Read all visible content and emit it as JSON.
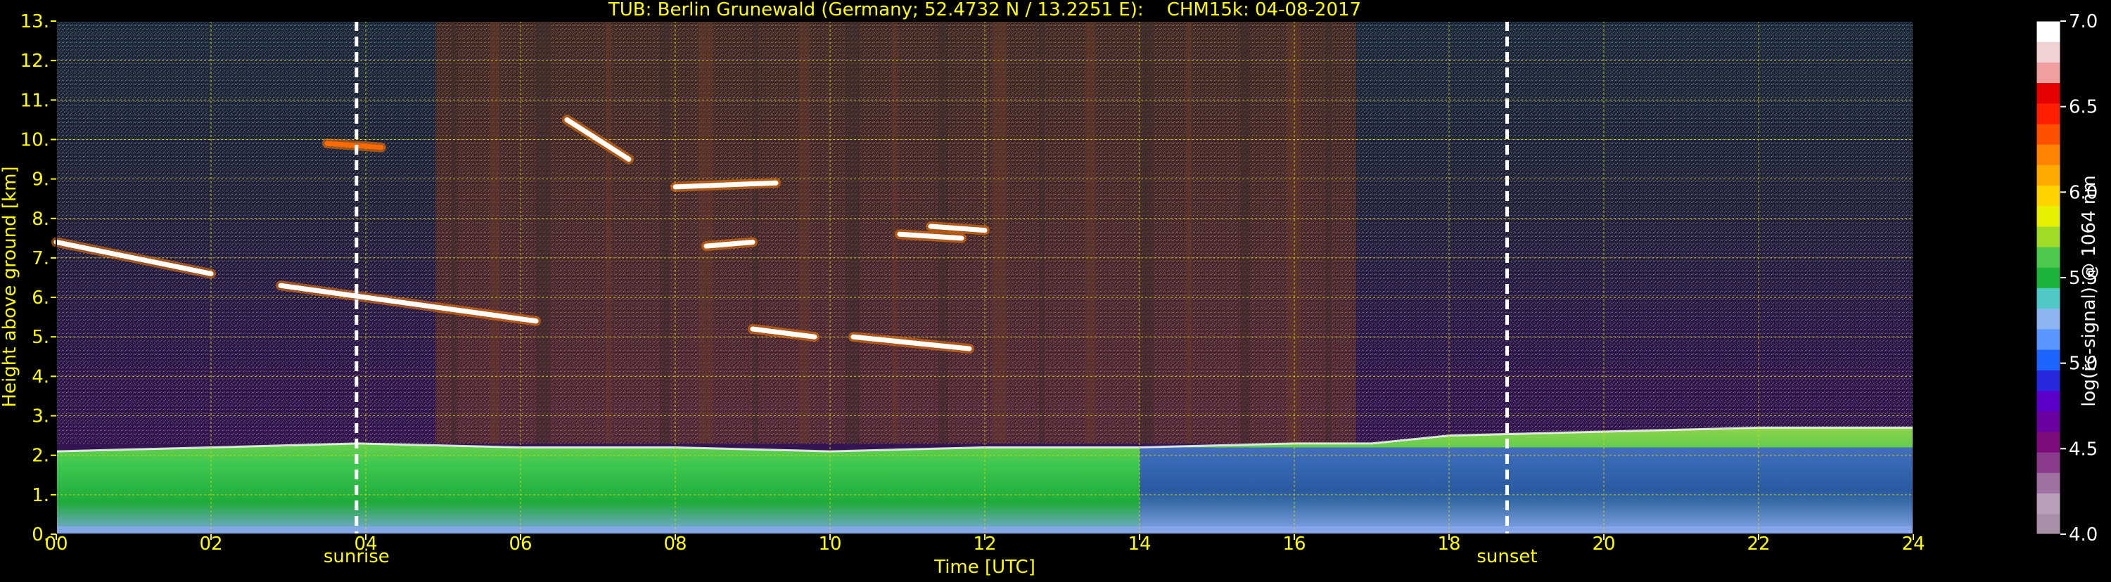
{
  "chart_data": {
    "type": "heatmap",
    "title": "TUB: Berlin Grunewald (Germany; 52.4732 N / 13.2251 E):    CHM15k: 04-08-2017",
    "xlabel": "Time [UTC]",
    "ylabel": "Height above ground [km]",
    "xlim": [
      0,
      24
    ],
    "ylim": [
      0,
      13
    ],
    "x_ticks": [
      "00",
      "02",
      "04",
      "06",
      "08",
      "10",
      "12",
      "14",
      "16",
      "18",
      "20",
      "22",
      "24"
    ],
    "y_ticks": [
      "0.",
      "1.",
      "2.",
      "3.",
      "4.",
      "5.",
      "6.",
      "7.",
      "8.",
      "9.",
      "10.",
      "11.",
      "12.",
      "13."
    ],
    "grid": true,
    "annotations": [
      {
        "label": "sunrise",
        "x": 3.88
      },
      {
        "label": "sunset",
        "x": 18.75
      }
    ],
    "colorbar": {
      "label": "log(rc-signal) @ 1064 nm",
      "range": [
        4.0,
        7.0
      ],
      "ticks": [
        "4.0",
        "4.5",
        "5.0",
        "5.5",
        "6.0",
        "6.5",
        "7.0"
      ],
      "colors": [
        "#a890a8",
        "#b8a0b8",
        "#a070a0",
        "#8c3c8c",
        "#7c0c7c",
        "#6a00a0",
        "#5a00c8",
        "#2828e0",
        "#1e64ff",
        "#5a96ff",
        "#8cb4f0",
        "#50c8c8",
        "#1eb43c",
        "#4cc84c",
        "#a0dc28",
        "#e6f000",
        "#ffd200",
        "#ffaa00",
        "#ff8200",
        "#ff5000",
        "#ff1e00",
        "#e60000",
        "#f0a0a0",
        "#f0d2d2",
        "#ffffff"
      ]
    },
    "boundary_layer_top_km": [
      [
        0,
        2.1
      ],
      [
        2,
        2.2
      ],
      [
        3.9,
        2.3
      ],
      [
        6,
        2.2
      ],
      [
        8,
        2.2
      ],
      [
        10,
        2.1
      ],
      [
        12,
        2.2
      ],
      [
        14,
        2.2
      ],
      [
        16,
        2.3
      ],
      [
        17,
        2.3
      ],
      [
        18,
        2.5
      ],
      [
        20,
        2.6
      ],
      [
        22,
        2.7
      ],
      [
        24,
        2.7
      ]
    ],
    "cloud_layers": [
      {
        "x": [
          0,
          2.0
        ],
        "y": [
          7.4,
          6.6
        ],
        "color": "#ffffff"
      },
      {
        "x": [
          2.9,
          6.2
        ],
        "y": [
          6.3,
          5.4
        ],
        "color": "#ffffff"
      },
      {
        "x": [
          8.0,
          9.3
        ],
        "y": [
          8.8,
          8.9
        ],
        "color": "#ffffff"
      },
      {
        "x": [
          8.4,
          9.0
        ],
        "y": [
          7.3,
          7.4
        ],
        "color": "#ffffff"
      },
      {
        "x": [
          9.0,
          9.8
        ],
        "y": [
          5.2,
          5.0
        ],
        "color": "#ffffff"
      },
      {
        "x": [
          10.3,
          11.8
        ],
        "y": [
          5.0,
          4.7
        ],
        "color": "#ffffff"
      },
      {
        "x": [
          10.9,
          11.7
        ],
        "y": [
          7.6,
          7.5
        ],
        "color": "#ffffff"
      },
      {
        "x": [
          11.3,
          12.0
        ],
        "y": [
          7.8,
          7.7
        ],
        "color": "#ffffff"
      },
      {
        "x": [
          3.5,
          4.2
        ],
        "y": [
          9.9,
          9.8
        ],
        "color": "#ff6a00"
      },
      {
        "x": [
          6.6,
          7.4
        ],
        "y": [
          10.5,
          9.5
        ],
        "color": "#ffffff"
      }
    ]
  }
}
